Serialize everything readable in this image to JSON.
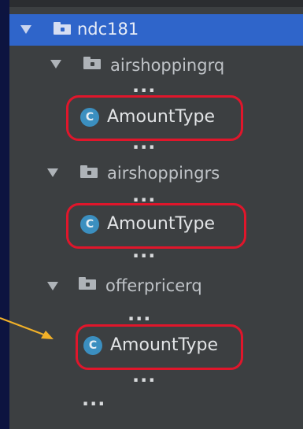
{
  "tree": {
    "root": {
      "label": "ndc181",
      "icon": "folder-icon",
      "expanded": true,
      "selected": true
    },
    "packages": [
      {
        "label": "airshoppingrq",
        "icon": "folder-icon",
        "expanded": true,
        "ellipsis_before": "...",
        "class_label": "AmountType",
        "class_icon_letter": "C",
        "ellipsis_after": "..."
      },
      {
        "label": "airshoppingrs",
        "icon": "folder-icon",
        "expanded": true,
        "ellipsis_before": "...",
        "class_label": "AmountType",
        "class_icon_letter": "C",
        "ellipsis_after": "..."
      },
      {
        "label": "offerpricerq",
        "icon": "folder-icon",
        "expanded": true,
        "ellipsis_before": "...",
        "class_label": "AmountType",
        "class_icon_letter": "C",
        "ellipsis_after": "..."
      }
    ],
    "trailing_ellipsis": "..."
  },
  "colors": {
    "background": "#0d1440",
    "panel": "#3c3f41",
    "selection": "#2f65ca",
    "highlight_box": "#e0162b",
    "arrow": "#f2b128",
    "class_icon": "#3b8fc0"
  }
}
